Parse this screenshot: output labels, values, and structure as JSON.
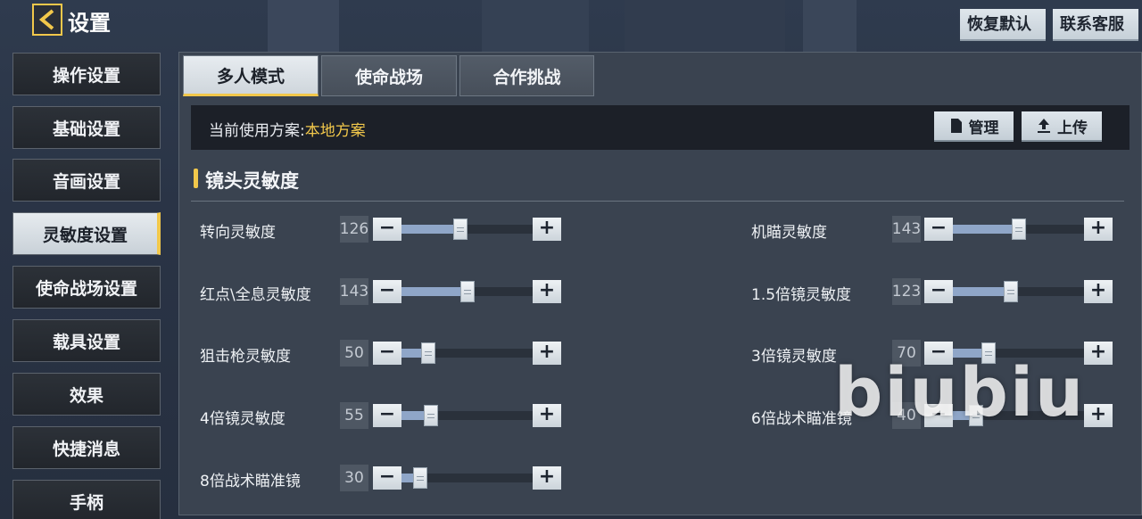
{
  "header": {
    "title": "设置",
    "restore_label": "恢复默认",
    "support_label": "联系客服"
  },
  "sidebar": {
    "items": [
      {
        "label": "操作设置"
      },
      {
        "label": "基础设置"
      },
      {
        "label": "音画设置"
      },
      {
        "label": "灵敏度设置",
        "active": true
      },
      {
        "label": "使命战场设置"
      },
      {
        "label": "载具设置"
      },
      {
        "label": "效果"
      },
      {
        "label": "快捷消息"
      },
      {
        "label": "手柄"
      }
    ]
  },
  "tabs": [
    {
      "label": "多人模式",
      "active": true
    },
    {
      "label": "使命战场"
    },
    {
      "label": "合作挑战"
    }
  ],
  "scheme": {
    "prefix": "当前使用方案:",
    "value": "本地方案",
    "manage_label": "管理",
    "upload_label": "上传"
  },
  "section": {
    "title": "镜头灵敏度"
  },
  "sliders_left": [
    {
      "label": "转向灵敏度",
      "value": "126",
      "level": 0.44
    },
    {
      "label": "红点\\全息灵敏度",
      "value": "143",
      "level": 0.5
    },
    {
      "label": "狙击枪灵敏度",
      "value": "50",
      "level": 0.17
    },
    {
      "label": "4倍镜灵敏度",
      "value": "55",
      "level": 0.19
    },
    {
      "label": "8倍战术瞄准镜",
      "value": "30",
      "level": 0.1
    }
  ],
  "sliders_right": [
    {
      "label": "机瞄灵敏度",
      "value": "143",
      "level": 0.5
    },
    {
      "label": "1.5倍镜灵敏度",
      "value": "123",
      "level": 0.43
    },
    {
      "label": "3倍镜灵敏度",
      "value": "70",
      "level": 0.24
    },
    {
      "label": "6倍战术瞄准镜",
      "value": "40",
      "level": 0.14
    }
  ],
  "minus_symbol": "−",
  "plus_symbol": "+",
  "watermark": "biubiu",
  "colors": {
    "accent": "#f2c84b",
    "fill": "#8fa6c8"
  }
}
